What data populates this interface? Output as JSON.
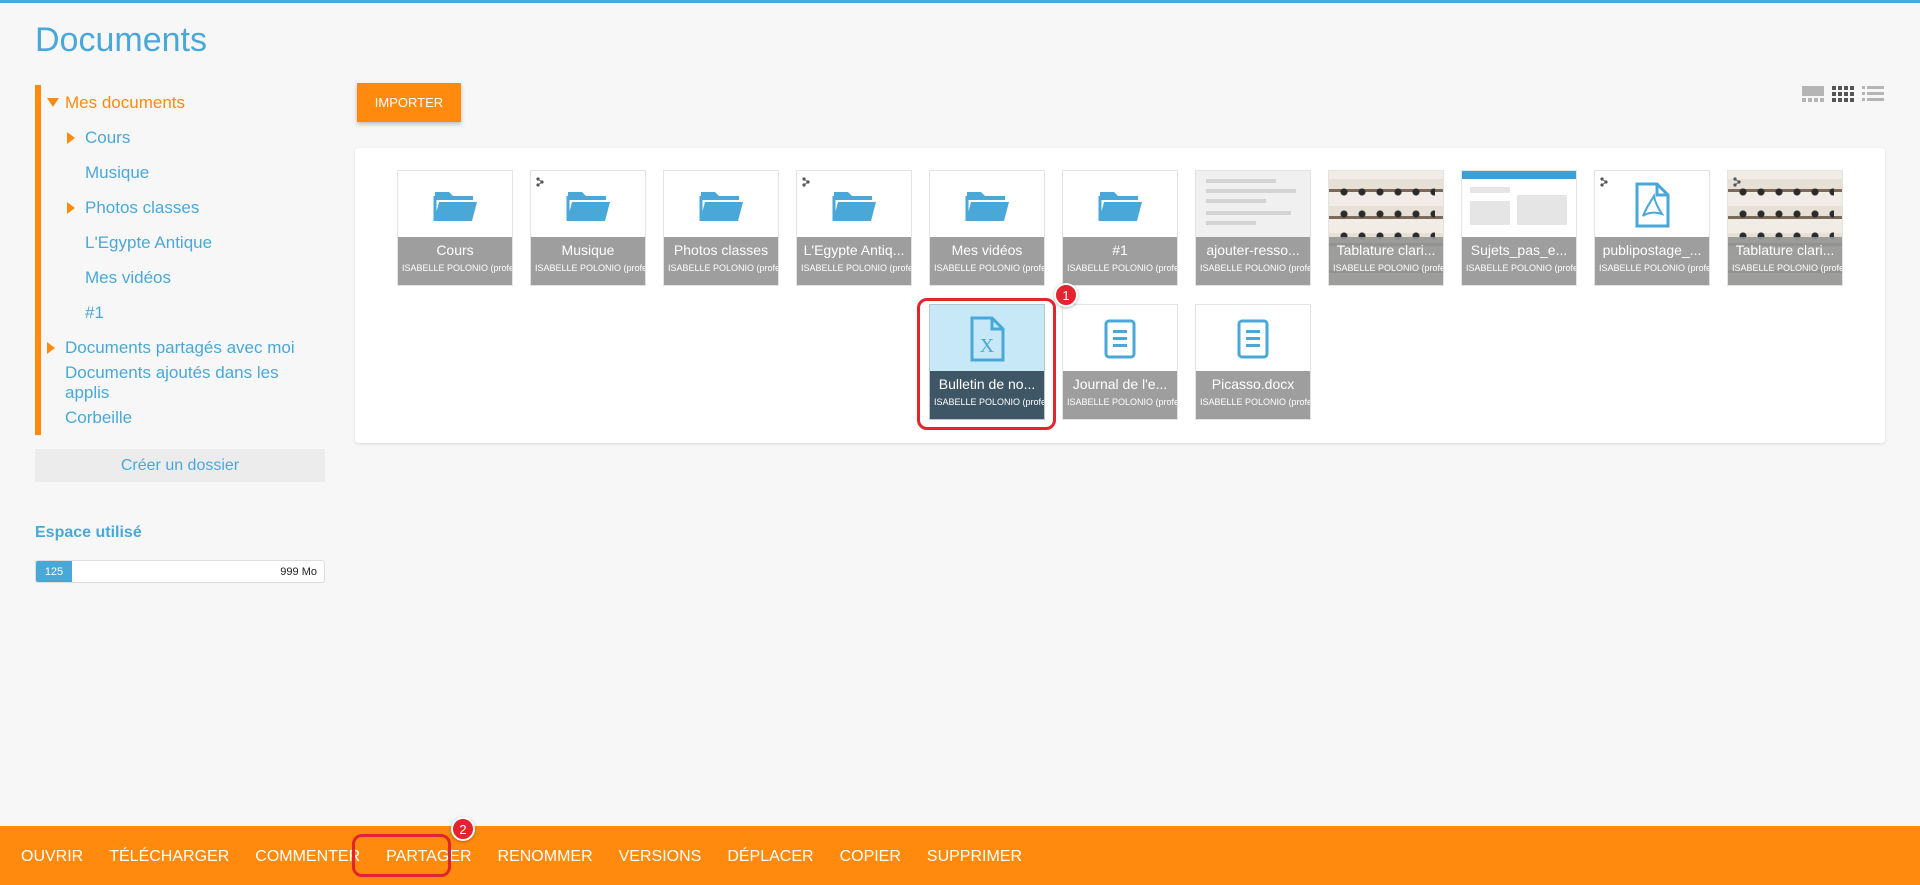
{
  "page": {
    "title": "Documents"
  },
  "sidebar": {
    "tree": [
      {
        "label": "Mes documents",
        "caret": "down",
        "active": true
      },
      {
        "label": "Cours",
        "caret": "right"
      },
      {
        "label": "Musique"
      },
      {
        "label": "Photos classes",
        "caret": "right"
      },
      {
        "label": "L'Egypte Antique"
      },
      {
        "label": "Mes vidéos"
      },
      {
        "label": "#1"
      },
      {
        "label": "Documents partagés avec moi",
        "caret": "right"
      },
      {
        "label": "Documents ajoutés dans les applis"
      },
      {
        "label": "Corbeille"
      }
    ],
    "create_folder_label": "Créer un dossier",
    "space": {
      "title": "Espace utilisé",
      "used": "125",
      "max": "999 Mo",
      "used_fraction": 0.125
    }
  },
  "toolbar": {
    "import_label": "IMPORTER",
    "views": [
      "carousel-view-icon",
      "grid-view-icon",
      "list-view-icon"
    ]
  },
  "files": [
    {
      "name": "Cours",
      "owner": "ISABELLE POLONIO (professeur)",
      "kind": "folder",
      "shared": false
    },
    {
      "name": "Musique",
      "owner": "ISABELLE POLONIO (professeur)",
      "kind": "folder",
      "shared": true
    },
    {
      "name": "Photos classes",
      "owner": "ISABELLE POLONIO (professeur)",
      "kind": "folder",
      "shared": false
    },
    {
      "name": "L'Egypte Antiq...",
      "owner": "ISABELLE POLONIO (professeur)",
      "kind": "folder",
      "shared": true
    },
    {
      "name": "Mes vidéos",
      "owner": "ISABELLE POLONIO (professeur)",
      "kind": "folder",
      "shared": false
    },
    {
      "name": "#1",
      "owner": "ISABELLE POLONIO (professeur)",
      "kind": "folder",
      "shared": false
    },
    {
      "name": "ajouter-resso...",
      "owner": "ISABELLE POLONIO (professeur)",
      "kind": "image-doc",
      "shared": false
    },
    {
      "name": "Tablature clari...",
      "owner": "ISABELLE POLONIO (professeur)",
      "kind": "image-tab",
      "shared": false
    },
    {
      "name": "Sujets_pas_e...",
      "owner": "ISABELLE POLONIO (professeur)",
      "kind": "image-blue",
      "shared": false
    },
    {
      "name": "publipostage_...",
      "owner": "ISABELLE POLONIO (professeur)",
      "kind": "pdf",
      "shared": true
    },
    {
      "name": "Tablature clari...",
      "owner": "ISABELLE POLONIO (professeur)",
      "kind": "image-tab",
      "shared": true
    },
    {
      "name": "Bulletin de no...",
      "owner": "ISABELLE POLONIO (professeur)",
      "kind": "excel",
      "shared": false,
      "selected": true
    },
    {
      "name": "Journal de l'e...",
      "owner": "ISABELLE POLONIO (professeur)",
      "kind": "text",
      "shared": false
    },
    {
      "name": "Picasso.docx",
      "owner": "ISABELLE POLONIO (professeur)",
      "kind": "text",
      "shared": false
    }
  ],
  "markers": {
    "step1": "1",
    "step2": "2"
  },
  "actions": [
    "OUVRIR",
    "TÉLÉCHARGER",
    "COMMENTER",
    "PARTAGER",
    "RENOMMER",
    "VERSIONS",
    "DÉPLACER",
    "COPIER",
    "SUPPRIMER"
  ],
  "colors": {
    "accent": "#ff8a0d",
    "primary": "#4aa8d8",
    "marker": "#e3232d"
  }
}
